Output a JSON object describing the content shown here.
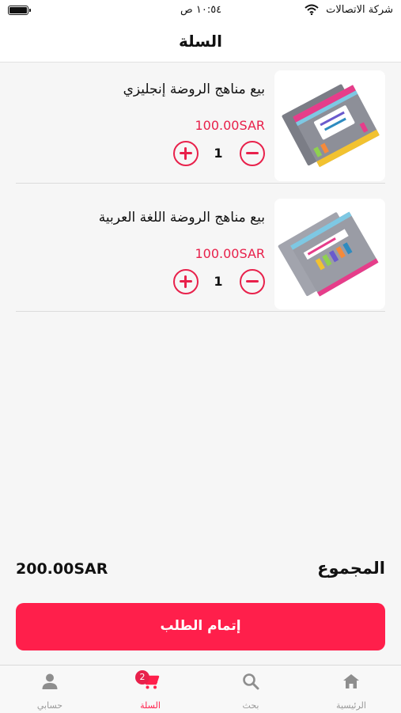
{
  "status_bar": {
    "carrier": "شركة الاتصالات",
    "time": "١٠:٥٤ ص"
  },
  "header": {
    "title": "السلة"
  },
  "cart": {
    "items": [
      {
        "name": "بيع مناهج الروضة إنجليزي",
        "price": "100.00SAR",
        "quantity": "1"
      },
      {
        "name": "بيع مناهج الروضة اللغة العربية",
        "price": "100.00SAR",
        "quantity": "1"
      }
    ]
  },
  "summary": {
    "total_label": "المجموع",
    "total_value": "200.00SAR",
    "checkout_label": "إتمام الطلب"
  },
  "bottom_nav": {
    "items": [
      {
        "label": "الرئيسية",
        "icon": "home-icon"
      },
      {
        "label": "بحث",
        "icon": "search-icon"
      },
      {
        "label": "السلة",
        "icon": "cart-icon",
        "badge": "2",
        "active": true
      },
      {
        "label": "حسابي",
        "icon": "person-icon"
      }
    ]
  },
  "colors": {
    "accent": "#ff1f4b",
    "price": "#e8214b",
    "background": "#f6f6f6"
  }
}
